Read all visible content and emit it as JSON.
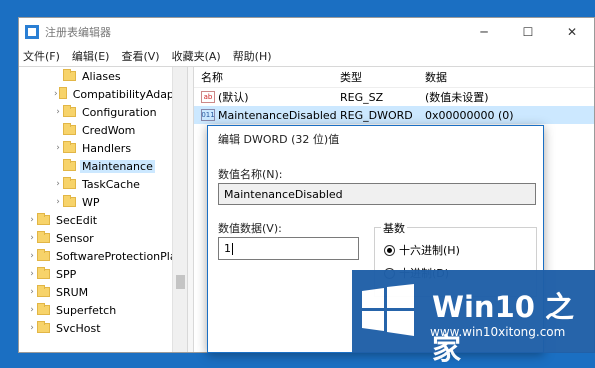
{
  "window": {
    "title": "注册表编辑器",
    "controls": {
      "minimize": "─",
      "maximize": "☐",
      "close": "✕"
    }
  },
  "menu": [
    "文件(F)",
    "编辑(E)",
    "查看(V)",
    "收藏夹(A)",
    "帮助(H)"
  ],
  "tree": {
    "items": [
      {
        "label": "Aliases",
        "chevron": "",
        "selected": false
      },
      {
        "label": "CompatibilityAdapte",
        "chevron": "›",
        "selected": false
      },
      {
        "label": "Configuration",
        "chevron": "›",
        "selected": false
      },
      {
        "label": "CredWom",
        "chevron": "",
        "selected": false
      },
      {
        "label": "Handlers",
        "chevron": "›",
        "selected": false
      },
      {
        "label": "Maintenance",
        "chevron": "",
        "selected": true
      },
      {
        "label": "TaskCache",
        "chevron": "›",
        "selected": false
      },
      {
        "label": "WP",
        "chevron": "›",
        "selected": false
      },
      {
        "label": "SecEdit",
        "chevron": "›",
        "selected": false
      },
      {
        "label": "Sensor",
        "chevron": "›",
        "selected": false
      },
      {
        "label": "SoftwareProtectionPlatf",
        "chevron": "›",
        "selected": false
      },
      {
        "label": "SPP",
        "chevron": "›",
        "selected": false
      },
      {
        "label": "SRUM",
        "chevron": "›",
        "selected": false
      },
      {
        "label": "Superfetch",
        "chevron": "›",
        "selected": false
      },
      {
        "label": "SvcHost",
        "chevron": "›",
        "selected": false
      }
    ]
  },
  "list": {
    "headers": {
      "name": "名称",
      "type": "类型",
      "data": "数据"
    },
    "rows": [
      {
        "icon": "ab",
        "name": "(默认)",
        "type": "REG_SZ",
        "data": "(数值未设置)",
        "selected": false
      },
      {
        "icon": "011",
        "name": "MaintenanceDisabled",
        "type": "REG_DWORD",
        "data": "0x00000000 (0)",
        "selected": true
      }
    ]
  },
  "dialog": {
    "title": "编辑 DWORD (32 位)值",
    "name_label": "数值名称(N):",
    "name_value": "MaintenanceDisabled",
    "data_label": "数值数据(V):",
    "data_value": "1",
    "base_label": "基数",
    "radio_hex": "十六进制(H)",
    "radio_dec": "十进制(D)"
  },
  "watermark": {
    "title": "Win10 之家",
    "url": "www.win10xitong.com",
    "colors": [
      "#f25022",
      "#7fba00",
      "#00a4ef",
      "#ffb900"
    ]
  }
}
